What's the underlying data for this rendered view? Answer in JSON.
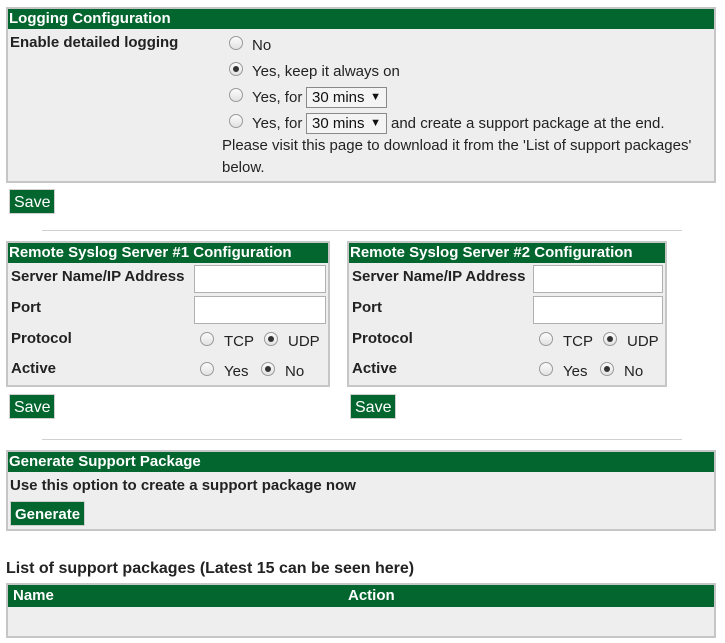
{
  "logging": {
    "title": "Logging Configuration",
    "field_label": "Enable detailed logging",
    "option_no": "No",
    "option_always": "Yes, keep it always on",
    "option_for": "Yes, for",
    "duration1": "30 mins",
    "duration2": "30 mins",
    "option_for_suffix": "and create a support package at the end.",
    "note_line1": "Please visit this page to download it from the 'List of support packages'",
    "note_line2": "below.",
    "save_label": "Save"
  },
  "syslog1": {
    "title": "Remote Syslog Server #1 Configuration",
    "server_label": "Server Name/IP Address",
    "port_label": "Port",
    "protocol_label": "Protocol",
    "tcp_label": "TCP",
    "udp_label": "UDP",
    "active_label": "Active",
    "yes_label": "Yes",
    "no_label": "No",
    "server_value": "",
    "port_value": "",
    "save_label": "Save"
  },
  "syslog2": {
    "title": "Remote Syslog Server #2 Configuration",
    "server_label": "Server Name/IP Address",
    "port_label": "Port",
    "protocol_label": "Protocol",
    "tcp_label": "TCP",
    "udp_label": "UDP",
    "active_label": "Active",
    "yes_label": "Yes",
    "no_label": "No",
    "server_value": "",
    "port_value": "",
    "save_label": "Save"
  },
  "support": {
    "title": "Generate Support Package",
    "description": "Use this option to create a support package now",
    "generate_label": "Generate"
  },
  "packages": {
    "heading": "List of support packages (Latest 15 can be seen here)",
    "col_name": "Name",
    "col_action": "Action"
  },
  "colors": {
    "header_green": "#03662e",
    "panel_bg": "#eeeeee",
    "panel_border": "#c6c6c6"
  }
}
